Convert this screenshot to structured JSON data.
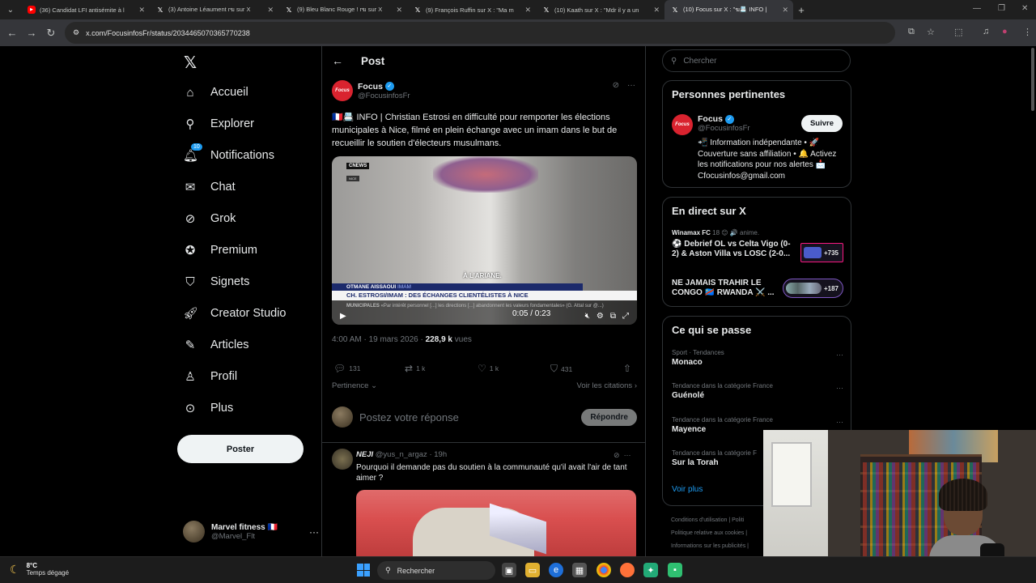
{
  "browser": {
    "tabs": [
      {
        "title": "(36) Candidat LFI antisémite à l",
        "icon": "youtube-icon",
        "active": false
      },
      {
        "title": "(3) Antoine Léaument rฆ sur X",
        "icon": "x-icon",
        "active": false
      },
      {
        "title": "(9) Bleu Blanc Rouge ! rฆ sur X",
        "icon": "x-icon",
        "active": false
      },
      {
        "title": "(9) François Ruffin sur X : \"Ma m",
        "icon": "x-icon",
        "active": false
      },
      {
        "title": "(10) Kaath sur X : \"Mdr il y a un",
        "icon": "x-icon",
        "active": false
      },
      {
        "title": "(10) Focus sur X : \"ฆ📇 INFO |",
        "icon": "x-icon",
        "active": true
      }
    ],
    "url": "x.com/FocusinfosFr/status/2034465070365770238"
  },
  "nav": {
    "items": [
      {
        "label": "Accueil",
        "icon": "home-icon"
      },
      {
        "label": "Explorer",
        "icon": "search-icon"
      },
      {
        "label": "Notifications",
        "icon": "bell-icon",
        "badge": "10"
      },
      {
        "label": "Chat",
        "icon": "mail-icon"
      },
      {
        "label": "Grok",
        "icon": "grok-icon"
      },
      {
        "label": "Premium",
        "icon": "premium-icon"
      },
      {
        "label": "Signets",
        "icon": "bookmark-icon"
      },
      {
        "label": "Creator Studio",
        "icon": "rocket-icon"
      },
      {
        "label": "Articles",
        "icon": "article-icon"
      },
      {
        "label": "Profil",
        "icon": "person-icon"
      },
      {
        "label": "Plus",
        "icon": "more-circle-icon"
      }
    ],
    "post_button": "Poster",
    "account": {
      "name": "Marvel fitness 🇫🇷",
      "handle": "@Marvel_Flt"
    }
  },
  "post": {
    "header_title": "Post",
    "author_name": "Focus",
    "author_handle": "@FocusinfosFr",
    "avatar_text": "Focus",
    "text": "🇫🇷📇 INFO | Christian Estrosi en difficulté pour remporter les élections municipales à Nice, filmé en plein échange avec un imam dans le but de recueillir le soutien d'électeurs musulmans.",
    "video": {
      "channel": "CNEWS",
      "location": "NICE",
      "overlay": "À L'ARIANE.",
      "name_strip": "OTMANE AISSAOUI",
      "name_role": "IMAM",
      "headline": "CH. ESTROSI/IMAM : DES ÉCHANGES CLIENTÉLISTES À NICE",
      "ticker_label": "MUNICIPALES",
      "ticker": "«Par intérêt personnel [...] les directions [...] abandonnent les valeurs fondamentales» (G. Attal sur @...)",
      "time": "0:05 / 0:23"
    },
    "timestamp": "4:00 AM · 19 mars 2026 · ",
    "views_count": "228,9 k",
    "views_label": " vues",
    "stats": {
      "replies": "131",
      "reposts": "1 k",
      "likes": "1 k",
      "bookmarks": "431"
    },
    "sort_label": "Pertinence",
    "quotes_label": "Voir les citations",
    "reply_placeholder": "Postez votre réponse",
    "reply_button": "Répondre"
  },
  "reply": {
    "name": "NEJI",
    "handle": "@yus_n_argaz",
    "time": "· 19h",
    "text": "Pourquoi il demande pas du soutien à la communauté qu'il avait l'air de tant aimer ?"
  },
  "sidebar": {
    "search_placeholder": "Chercher",
    "people": {
      "title": "Personnes pertinentes",
      "name": "Focus",
      "handle": "@FocusinfosFr",
      "follow": "Suivre",
      "bio": "📲 Information indépendante • 🚀 Couverture sans affiliation • 🔔 Activez les notifications pour nos alertes 📩 Cfocusinfos@gmail.com"
    },
    "live": {
      "title": "En direct sur X",
      "items": [
        {
          "source": "Winamax FC",
          "extra": "18 😊 🔊 anime.",
          "title": "⚽ Debrief OL vs Celta Vigo (0-2) & Aston Villa vs LOSC (2-0...",
          "count": "+735"
        },
        {
          "source": "",
          "extra": "",
          "title": "NE JAMAIS TRAHIR LE CONGO 🇨🇩 RWANDA ⚔️ ...",
          "count": "+187"
        }
      ]
    },
    "trends": {
      "title": "Ce qui se passe",
      "items": [
        {
          "category": "Sport · Tendances",
          "name": "Monaco"
        },
        {
          "category": "Tendance dans la catégorie France",
          "name": "Guénolé"
        },
        {
          "category": "Tendance dans la catégorie France",
          "name": "Mayence"
        },
        {
          "category": "Tendance dans la catégorie F",
          "name": "Sur la Torah"
        }
      ],
      "more": "Voir plus"
    },
    "footer": [
      "Conditions d'utilisation  |  Politi",
      "Politique relative aux cookies  |",
      "Informations sur les publicités  |"
    ]
  },
  "taskbar": {
    "temp": "8°C",
    "weather": "Temps dégagé",
    "search": "Rechercher"
  }
}
